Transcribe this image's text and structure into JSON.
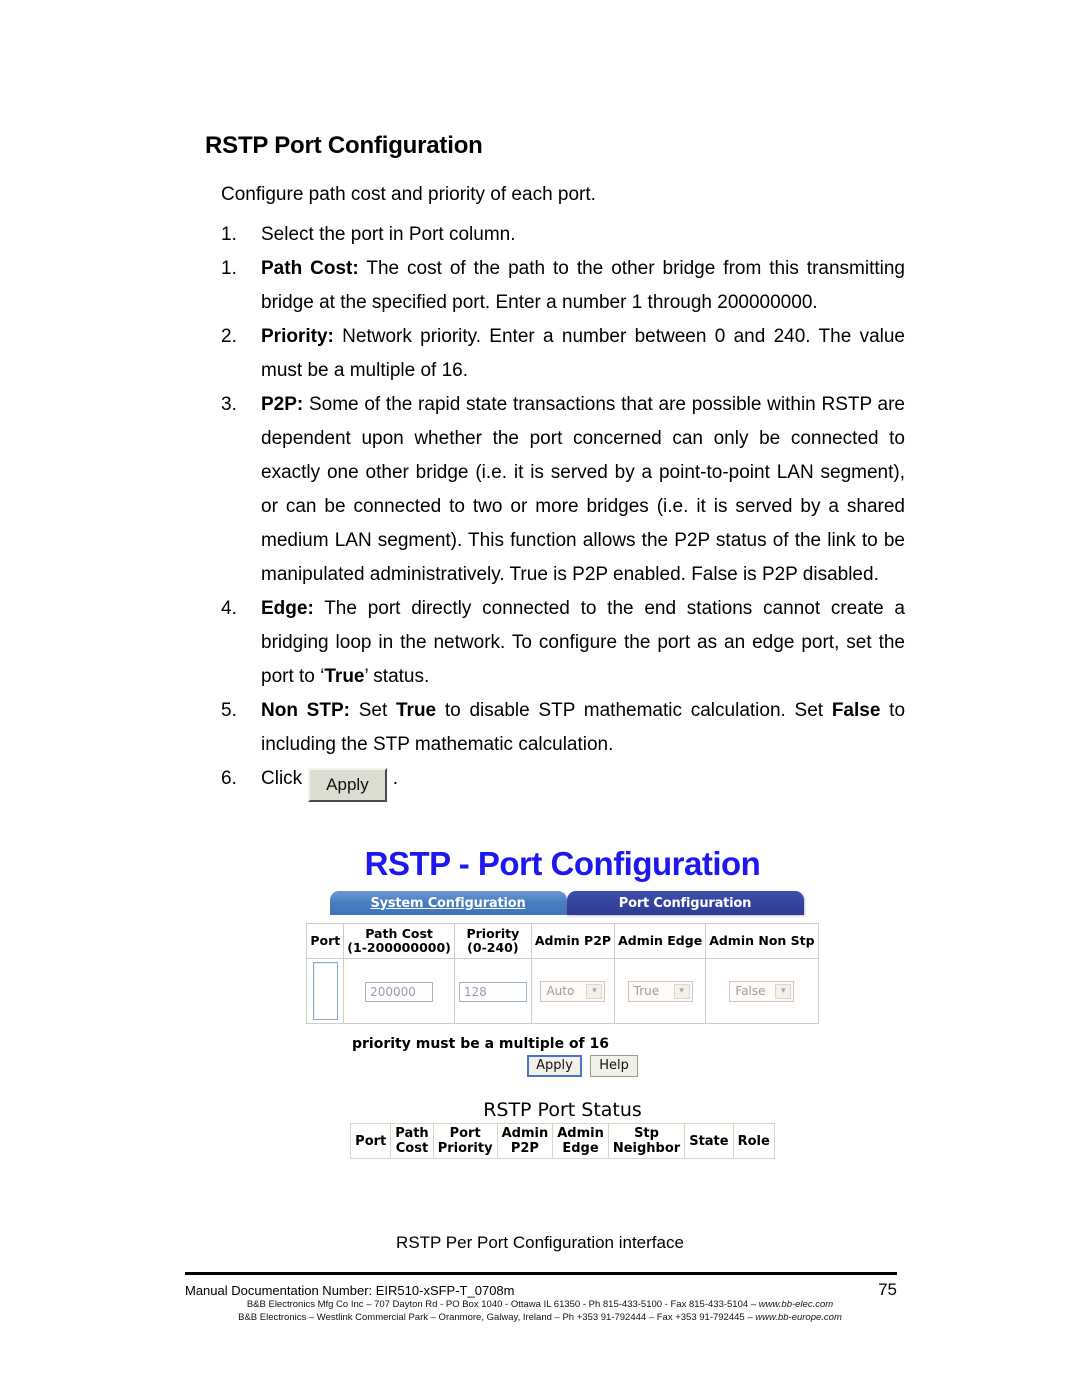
{
  "page": {
    "section_title": "RSTP Port Configuration",
    "intro": "Configure path cost and priority of each port.",
    "caption": "RSTP Per Port Configuration interface",
    "page_number": "75",
    "footer_doc": "Manual Documentation Number: EIR510-xSFP-T_0708m",
    "address_line1_a": "B&B Electronics Mfg Co Inc – 707 Dayton Rd - PO Box 1040 - Ottawa IL 61350 - Ph 815-433-5100 - Fax 815-433-5104 – ",
    "address_line1_url": "www.bb-elec.com",
    "address_line2_a": "B&B Electronics – Westlink Commercial Park – Oranmore, Galway, Ireland – Ph +353 91-792444 – Fax +353 91-792445 – ",
    "address_line2_url": "www.bb-europe.com"
  },
  "steps": [
    {
      "num": "1.",
      "lead": "",
      "text": "Select the port in Port column."
    },
    {
      "num": "1.",
      "lead": "Path Cost:",
      "text": " The cost of the path to the other bridge from this transmitting bridge at the specified port. Enter a number 1 through 200000000."
    },
    {
      "num": "2.",
      "lead": "Priority:",
      "text": " Network priority. Enter a number between 0 and 240. The value must be a multiple of 16."
    },
    {
      "num": "3.",
      "lead": "P2P:",
      "text": " Some of the rapid state transactions that are possible within RSTP are dependent upon whether the port concerned can only be connected to exactly one other bridge (i.e. it is served by a point-to-point LAN segment), or can be connected to two or more bridges (i.e. it is served by a shared medium LAN segment). This function allows the P2P status of the link to be manipulated administratively. True is P2P enabled. False is P2P disabled."
    },
    {
      "num": "4.",
      "lead": "Edge:",
      "text_a": " The port directly connected to the end stations cannot create a bridging loop in the network. To configure the port as an edge port, set the port to ‘",
      "bold_b": "True",
      "text_c": "’ status."
    },
    {
      "num": "5.",
      "lead": "Non STP:",
      "text_a": " Set ",
      "bold_b": "True",
      "text_c": " to disable STP mathematic calculation. Set ",
      "bold_d": "False",
      "text_e": " to including the STP mathematic calculation."
    },
    {
      "num": "6.",
      "click_label": "Click",
      "button_label": "Apply",
      "trailing": "."
    }
  ],
  "webui": {
    "title": "RSTP - Port Configuration",
    "tabs": [
      {
        "label": "System Configuration",
        "active": false
      },
      {
        "label": "Port Configuration",
        "active": true
      }
    ],
    "config_table": {
      "headers": [
        {
          "line1": "Port",
          "line2": ""
        },
        {
          "line1": "Path Cost",
          "line2": "(1-200000000)"
        },
        {
          "line1": "Priority",
          "line2": "(0-240)"
        },
        {
          "line1": "Admin P2P",
          "line2": ""
        },
        {
          "line1": "Admin Edge",
          "line2": ""
        },
        {
          "line1": "Admin Non Stp",
          "line2": ""
        }
      ],
      "row": {
        "port_value": "",
        "path_cost_value": "200000",
        "priority_value": "128",
        "admin_p2p_value": "Auto",
        "admin_edge_value": "True",
        "admin_non_stp_value": "False"
      }
    },
    "note": "priority must be a multiple of 16",
    "buttons": {
      "apply": "Apply",
      "help": "Help"
    },
    "status": {
      "title": "RSTP Port Status",
      "headers": [
        {
          "line1": "Port",
          "line2": ""
        },
        {
          "line1": "Path",
          "line2": "Cost"
        },
        {
          "line1": "Port",
          "line2": "Priority"
        },
        {
          "line1": "Admin",
          "line2": "P2P"
        },
        {
          "line1": "Admin",
          "line2": "Edge"
        },
        {
          "line1": "Stp",
          "line2": "Neighbor"
        },
        {
          "line1": "State",
          "line2": ""
        },
        {
          "line1": "Role",
          "line2": ""
        }
      ]
    }
  },
  "colors": {
    "title_blue": "#1c18ef",
    "tab_inactive": "#4a7ec2",
    "tab_active": "#33449e"
  }
}
